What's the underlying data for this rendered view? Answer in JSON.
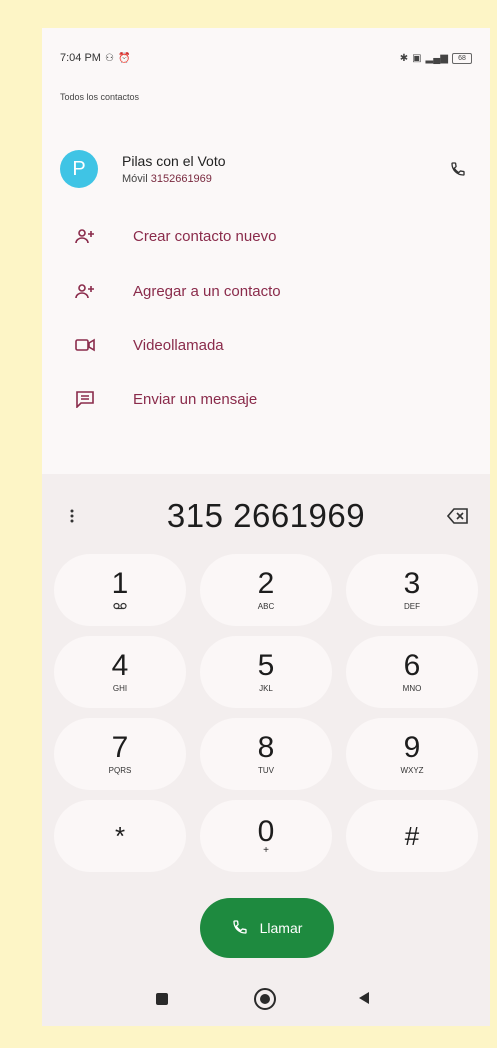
{
  "status_bar": {
    "time": "7:04 PM",
    "battery": "68"
  },
  "section_label": "Todos los contactos",
  "contact": {
    "avatar_letter": "P",
    "name": "Pilas con el Voto",
    "number_type": "Móvil",
    "number": "3152661969",
    "avatar_color": "#3fc4e5"
  },
  "actions": [
    {
      "label": "Crear contacto nuevo",
      "icon": "add-person-icon"
    },
    {
      "label": "Agregar a un contacto",
      "icon": "add-person-icon"
    },
    {
      "label": "Videollamada",
      "icon": "video-icon"
    },
    {
      "label": "Enviar un mensaje",
      "icon": "message-icon"
    }
  ],
  "dialpad": {
    "dialed_number": "315 2661969",
    "keys": [
      {
        "digit": "1",
        "letters": "ᅇ"
      },
      {
        "digit": "2",
        "letters": "ABC"
      },
      {
        "digit": "3",
        "letters": "DEF"
      },
      {
        "digit": "4",
        "letters": "GHI"
      },
      {
        "digit": "5",
        "letters": "JKL"
      },
      {
        "digit": "6",
        "letters": "MNO"
      },
      {
        "digit": "7",
        "letters": "PQRS"
      },
      {
        "digit": "8",
        "letters": "TUV"
      },
      {
        "digit": "9",
        "letters": "WXYZ"
      },
      {
        "digit": "*",
        "letters": ""
      },
      {
        "digit": "0",
        "letters": "+"
      },
      {
        "digit": "#",
        "letters": ""
      }
    ]
  },
  "call_button": {
    "label": "Llamar",
    "color": "#1e8a3f"
  },
  "accent_color": "#8a2b4b"
}
